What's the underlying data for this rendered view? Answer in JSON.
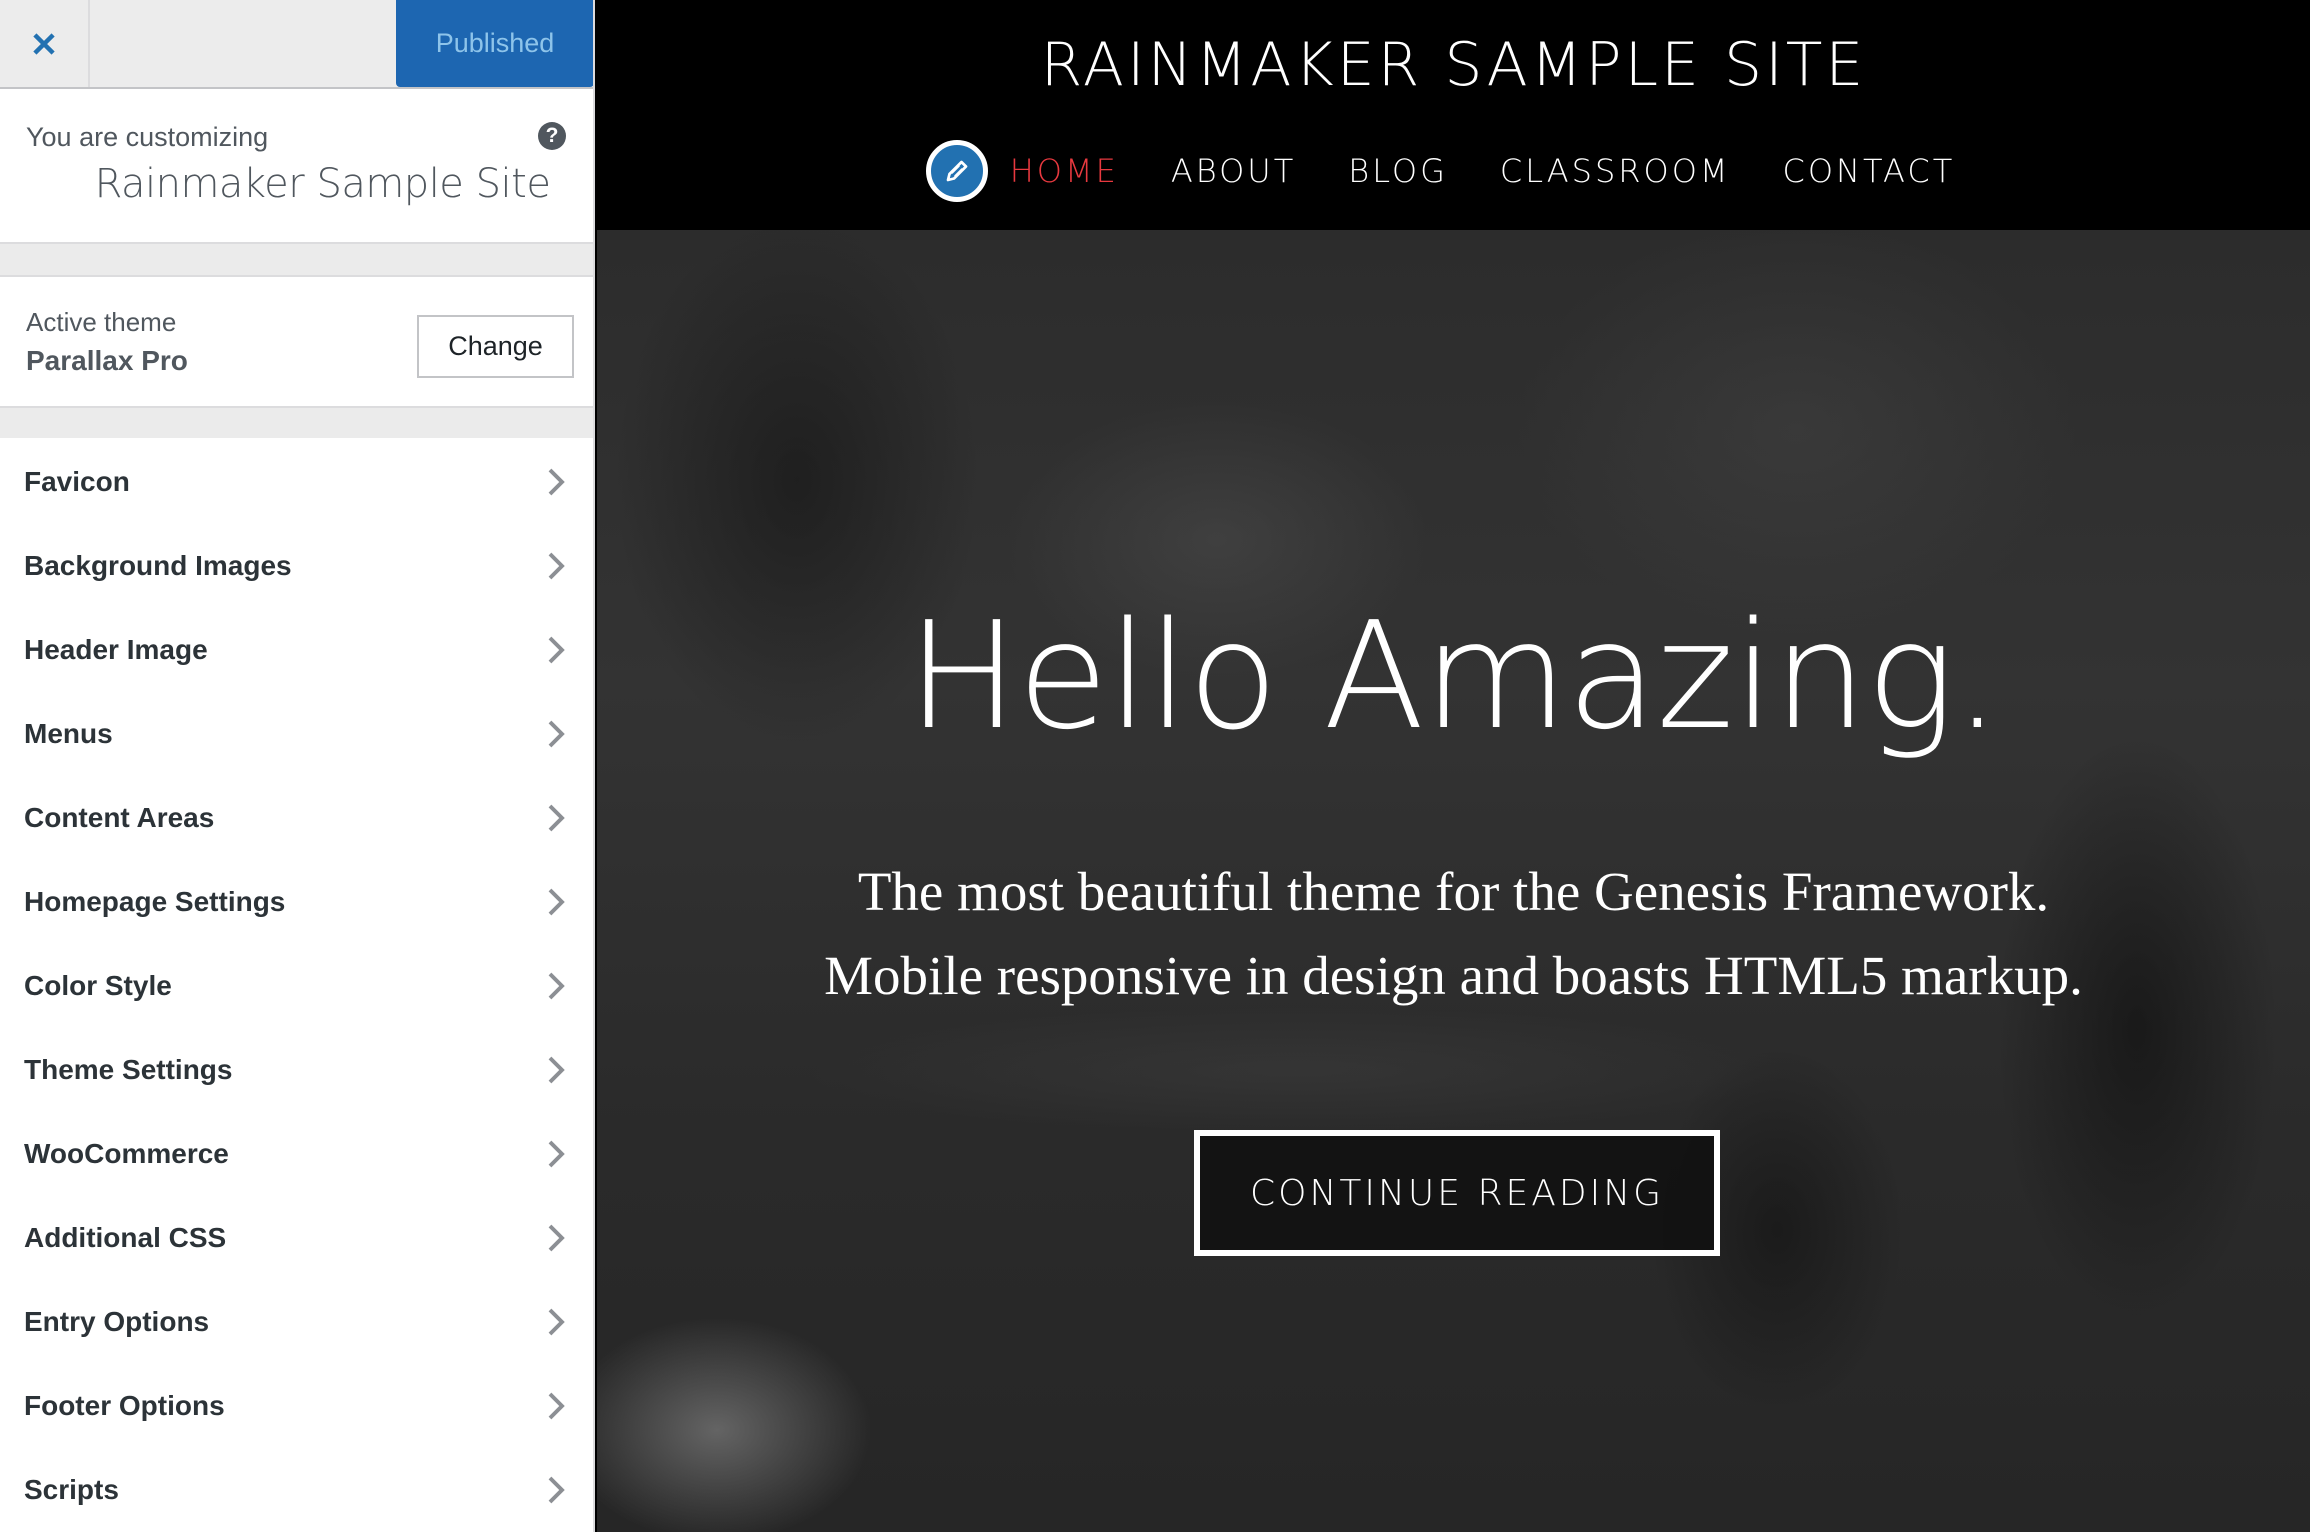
{
  "customizer": {
    "close_label": "Close",
    "publish_label": "Published",
    "info": {
      "label": "You are customizing",
      "site_title": "Rainmaker Sample Site",
      "help_glyph": "?"
    },
    "theme": {
      "label": "Active theme",
      "name": "Parallax Pro",
      "change_label": "Change"
    },
    "sections": [
      {
        "label": "Favicon"
      },
      {
        "label": "Background Images"
      },
      {
        "label": "Header Image"
      },
      {
        "label": "Menus"
      },
      {
        "label": "Content Areas"
      },
      {
        "label": "Homepage Settings"
      },
      {
        "label": "Color Style"
      },
      {
        "label": "Theme Settings"
      },
      {
        "label": "WooCommerce"
      },
      {
        "label": "Additional CSS"
      },
      {
        "label": "Entry Options"
      },
      {
        "label": "Footer Options"
      },
      {
        "label": "Scripts"
      }
    ]
  },
  "preview": {
    "site_title": "RAINMAKER SAMPLE SITE",
    "nav": [
      {
        "label": "HOME",
        "active": true
      },
      {
        "label": "ABOUT",
        "active": false
      },
      {
        "label": "BLOG",
        "active": false
      },
      {
        "label": "CLASSROOM",
        "active": false
      },
      {
        "label": "CONTACT",
        "active": false
      }
    ],
    "hero": {
      "title": "Hello Amazing.",
      "subtitle_line1": "The most beautiful theme for the Genesis Framework.",
      "subtitle_line2": "Mobile responsive in design and boasts HTML5 markup.",
      "cta_label": "CONTINUE READING"
    }
  },
  "colors": {
    "publish_button": "#1d66b1",
    "close_icon": "#2271b1",
    "nav_active": "#e8393f",
    "header_bg": "#000000"
  }
}
